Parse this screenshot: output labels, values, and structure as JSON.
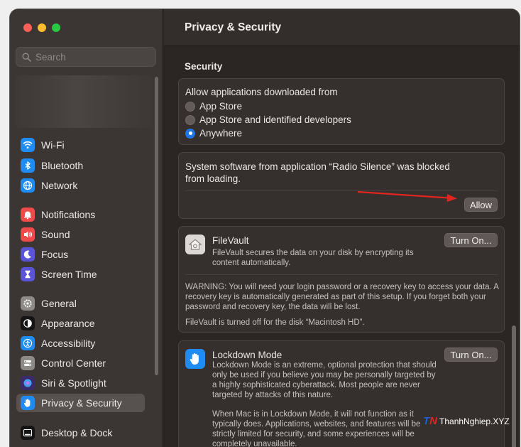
{
  "sidebar": {
    "search_placeholder": "Search",
    "items": [
      {
        "label": "Wi-Fi",
        "icon": "wifi-icon",
        "color": "#1f8cf4"
      },
      {
        "label": "Bluetooth",
        "icon": "bluetooth-icon",
        "color": "#1f8cf4"
      },
      {
        "label": "Network",
        "icon": "globe-icon",
        "color": "#1f8cf4"
      },
      {
        "label": "Notifications",
        "icon": "bell-icon",
        "color": "#f04a4a"
      },
      {
        "label": "Sound",
        "icon": "speaker-icon",
        "color": "#f04a4a"
      },
      {
        "label": "Focus",
        "icon": "moon-icon",
        "color": "#5b53d8"
      },
      {
        "label": "Screen Time",
        "icon": "hourglass-icon",
        "color": "#5b53d8"
      },
      {
        "label": "General",
        "icon": "gear-icon",
        "color": "#8e8a88"
      },
      {
        "label": "Appearance",
        "icon": "appearance-icon",
        "color": "#151515"
      },
      {
        "label": "Accessibility",
        "icon": "accessibility-icon",
        "color": "#1f8cf4"
      },
      {
        "label": "Control Center",
        "icon": "control-center-icon",
        "color": "#8e8a88"
      },
      {
        "label": "Siri & Spotlight",
        "icon": "siri-icon",
        "color": "#3a2a6c"
      },
      {
        "label": "Privacy & Security",
        "icon": "hand-icon",
        "color": "#1f8cf4"
      },
      {
        "label": "Desktop & Dock",
        "icon": "dock-icon",
        "color": "#151515"
      }
    ]
  },
  "main": {
    "title": "Privacy & Security",
    "section_title": "Security",
    "downloads": {
      "heading": "Allow applications downloaded from",
      "options": [
        "App Store",
        "App Store and identified developers",
        "Anywhere"
      ],
      "selected": "Anywhere"
    },
    "blocked": {
      "message": "System software from application “Radio Silence” was blocked from loading.",
      "allow_label": "Allow"
    },
    "filevault": {
      "title": "FileVault",
      "description": "FileVault secures the data on your disk by encrypting its content automatically.",
      "button_label": "Turn On...",
      "warning": "WARNING: You will need your login password or a recovery key to access your data. A recovery key is automatically generated as part of this setup. If you forget both your password and recovery key, the data will be lost.",
      "status": "FileVault is turned off for the disk “Macintosh HD”."
    },
    "lockdown": {
      "title": "Lockdown Mode",
      "description": "Lockdown Mode is an extreme, optional protection that should only be used if you believe you may be personally targeted by a highly sophisticated cyberattack. Most people are never targeted by attacks of this nature.",
      "button_label": "Turn On...",
      "details": "When Mac is in Lockdown Mode, it will not function as it typically does. Applications, websites, and features will be strictly limited for security, and some experiences will be completely unavailable."
    }
  },
  "watermark": {
    "logo": "TN",
    "text": "ThanhNghiep.XYZ"
  },
  "colors": {
    "accent": "#1f75e6",
    "annotation_arrow": "#e0261f"
  }
}
